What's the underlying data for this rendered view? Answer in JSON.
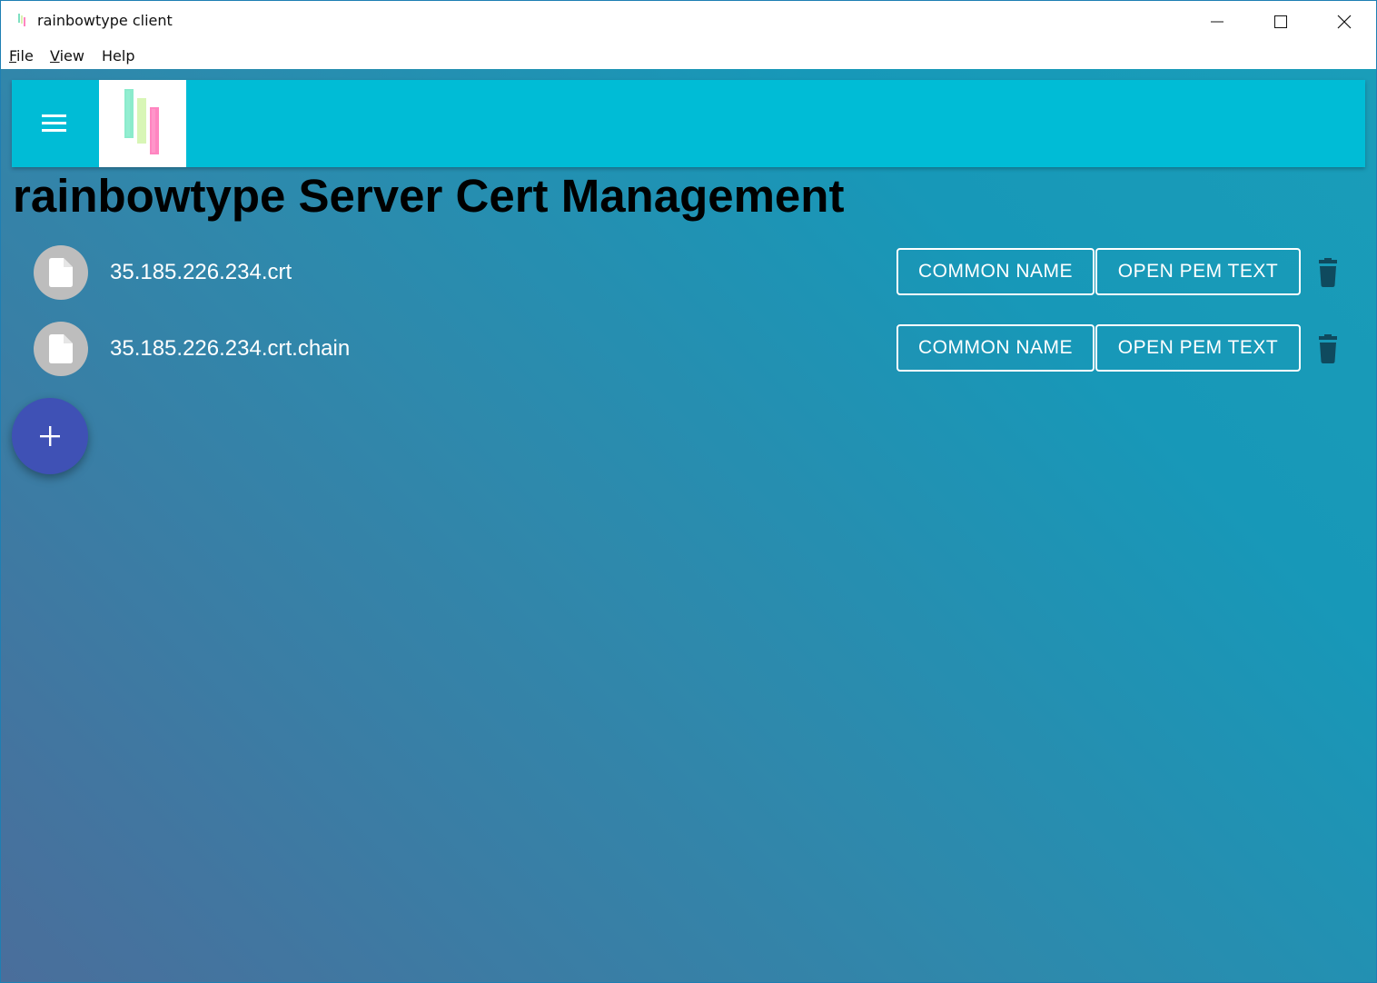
{
  "window": {
    "title": "rainbowtype client"
  },
  "menu": {
    "file": {
      "mnemonic": "F",
      "rest": "ile"
    },
    "view": {
      "mnemonic": "V",
      "rest": "iew"
    },
    "help": {
      "label": "Help"
    }
  },
  "header": {
    "menu_icon": "hamburger-menu-icon",
    "logo": "rainbowtype-logo"
  },
  "page": {
    "title": "rainbowtype Server Cert Management"
  },
  "certs": [
    {
      "name": "35.185.226.234.crt",
      "common_name_label": "COMMON NAME",
      "open_pem_label": "OPEN PEM TEXT"
    },
    {
      "name": "35.185.226.234.crt.chain",
      "common_name_label": "COMMON NAME",
      "open_pem_label": "OPEN PEM TEXT"
    }
  ],
  "icons": {
    "file": "file-icon",
    "delete": "trash-icon",
    "add": "plus-icon"
  },
  "colors": {
    "appbar": "#00bcd6",
    "fab": "#3f51b5",
    "avatar": "#bdbdbd",
    "trash": "#0f4a5e",
    "background_start": "#4a6e9b",
    "background_end": "#1a9db9"
  }
}
